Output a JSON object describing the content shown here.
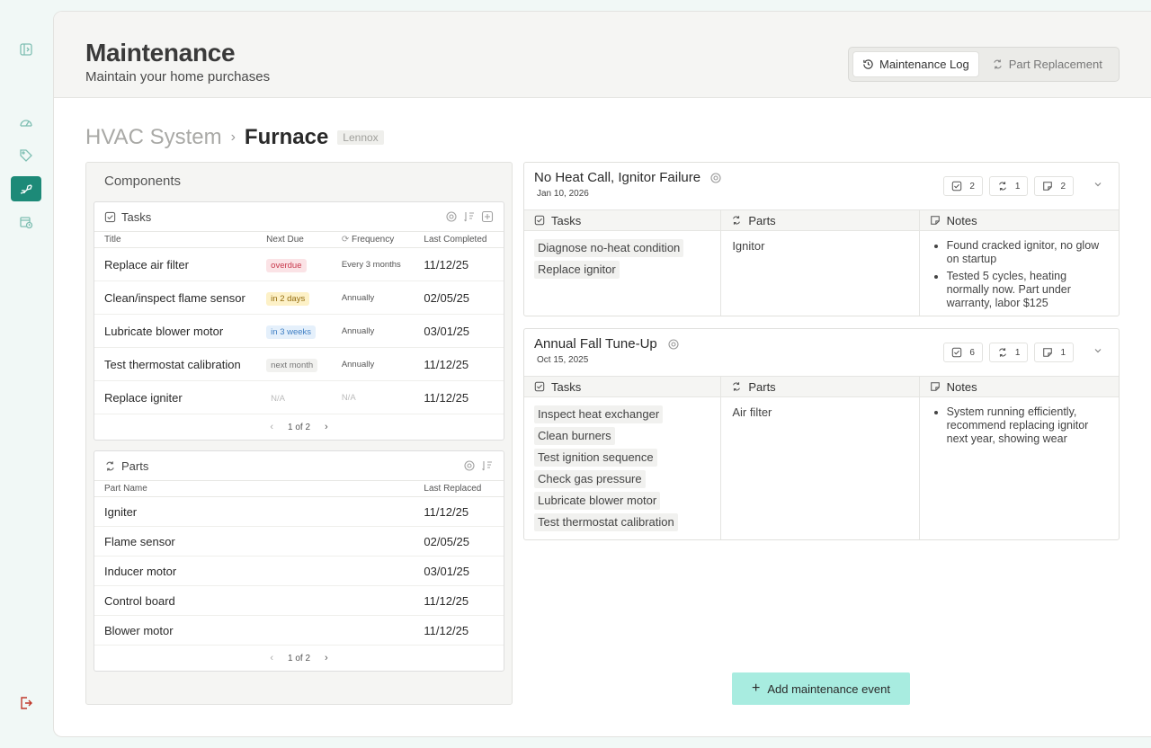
{
  "sidebar": {
    "items": [
      {
        "icon": "sidebar-toggle-icon"
      },
      {
        "icon": "dashboard-gauge-icon"
      },
      {
        "icon": "tag-icon"
      },
      {
        "icon": "maintenance-icon",
        "active": true
      },
      {
        "icon": "schedule-icon"
      },
      {
        "icon": "logout-icon"
      }
    ]
  },
  "header": {
    "title": "Maintenance",
    "subtitle": "Maintain your home purchases",
    "tabs": [
      {
        "label": "Maintenance Log",
        "icon": "history-icon",
        "active": true
      },
      {
        "label": "Part Replacement",
        "icon": "part-replace-icon",
        "active": false
      }
    ]
  },
  "breadcrumb": {
    "parent": "HVAC System",
    "current": "Furnace",
    "badge": "Lennox"
  },
  "components": {
    "title": "Components",
    "tasks": {
      "title": "Tasks",
      "columns": {
        "title": "Title",
        "next_due": "Next Due",
        "frequency": "Frequency",
        "last_completed": "Last Completed"
      },
      "rows": [
        {
          "title": "Replace air filter",
          "due": "overdue",
          "due_status": "red",
          "frequency": "Every 3 months",
          "last": "11/12/25"
        },
        {
          "title": "Clean/inspect flame sensor",
          "due": "in 2 days",
          "due_status": "yellow",
          "frequency": "Annually",
          "last": "02/05/25"
        },
        {
          "title": "Lubricate blower motor",
          "due": "in 3 weeks",
          "due_status": "blue",
          "frequency": "Annually",
          "last": "03/01/25"
        },
        {
          "title": "Test thermostat calibration",
          "due": "next month",
          "due_status": "grey",
          "frequency": "Annually",
          "last": "11/12/25"
        },
        {
          "title": "Replace igniter",
          "due": "N/A",
          "due_status": "na",
          "frequency": "N/A",
          "last": "11/12/25"
        }
      ],
      "pager": "1 of 2"
    },
    "parts": {
      "title": "Parts",
      "columns": {
        "name": "Part Name",
        "last_replaced": "Last Replaced"
      },
      "rows": [
        {
          "name": "Igniter",
          "last": "11/12/25"
        },
        {
          "name": "Flame sensor",
          "last": "02/05/25"
        },
        {
          "name": "Inducer motor",
          "last": "03/01/25"
        },
        {
          "name": "Control board",
          "last": "11/12/25"
        },
        {
          "name": "Blower motor",
          "last": "11/12/25"
        }
      ],
      "pager": "1 of 2"
    }
  },
  "events": [
    {
      "title": "No Heat Call, Ignitor Failure",
      "date": "Jan 10, 2026",
      "counts": {
        "tasks": "2",
        "parts": "1",
        "notes": "2"
      },
      "col_tasks": "Tasks",
      "col_parts": "Parts",
      "col_notes": "Notes",
      "tasks": [
        "Diagnose no-heat condition",
        "Replace ignitor"
      ],
      "parts": "Ignitor",
      "notes": [
        "Found cracked ignitor, no glow on startup",
        "Tested 5 cycles, heating normally now. Part under warranty, labor $125"
      ]
    },
    {
      "title": "Annual Fall Tune-Up",
      "date": "Oct 15, 2025",
      "counts": {
        "tasks": "6",
        "parts": "1",
        "notes": "1"
      },
      "col_tasks": "Tasks",
      "col_parts": "Parts",
      "col_notes": "Notes",
      "tasks": [
        "Inspect heat exchanger",
        "Clean burners",
        "Test ignition sequence",
        "Check gas pressure",
        "Lubricate blower motor",
        "Test thermostat calibration"
      ],
      "parts": "Air filter",
      "notes": [
        "System running efficiently, recommend replacing ignitor next year, showing wear"
      ]
    }
  ],
  "add_button": {
    "label": "Add maintenance event",
    "icon": "plus-icon"
  },
  "colors": {
    "accent": "#1d8a78",
    "add_button_bg": "#a8ece0",
    "logout": "#c0392b"
  }
}
